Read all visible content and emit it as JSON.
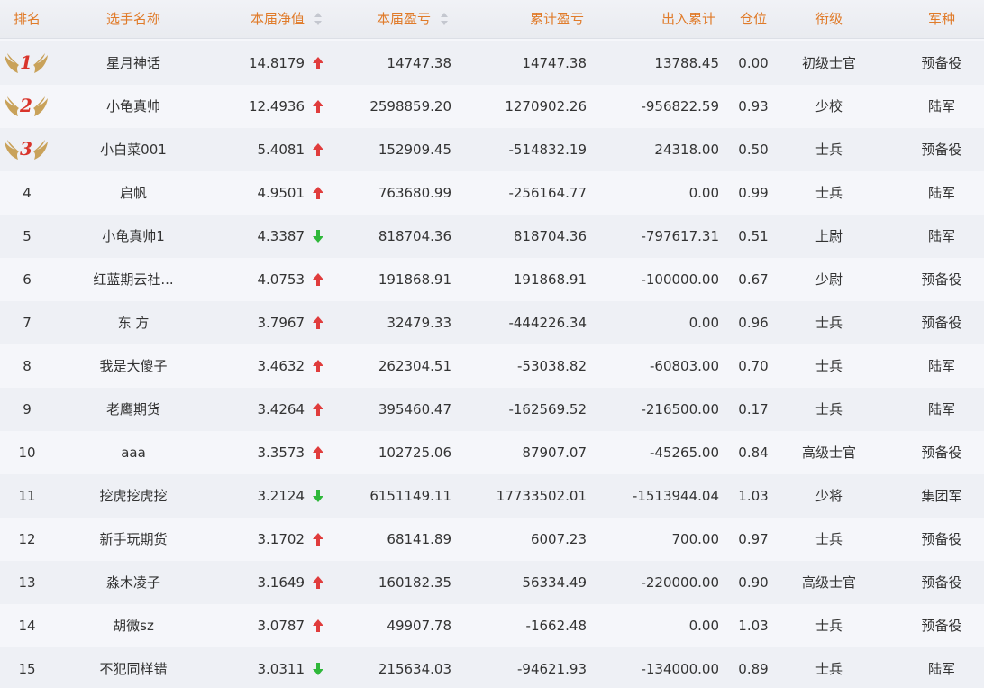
{
  "headers": {
    "rank": "排名",
    "name": "选手名称",
    "net_value": "本届净值",
    "profit": "本届盈亏",
    "cum_profit": "累计盈亏",
    "in_out": "出入累计",
    "position": "仓位",
    "grade": "衔级",
    "branch": "军种"
  },
  "colors": {
    "header_text": "#e07b2a",
    "up_arrow": "#e03c3c",
    "down_arrow": "#2fb83a",
    "medal_wing": "#c9a25a",
    "medal_number": "#d9342b"
  },
  "icons": {
    "sort": "sort-icon",
    "up": "arrow-up-icon",
    "down": "arrow-down-icon",
    "medal": "winged-medal-icon"
  },
  "rows": [
    {
      "rank": "1",
      "name": "星月神话",
      "net_value": "14.8179",
      "trend": "up",
      "profit": "14747.38",
      "cum_profit": "14747.38",
      "in_out": "13788.45",
      "position": "0.00",
      "grade": "初级士官",
      "branch": "预备役"
    },
    {
      "rank": "2",
      "name": "小龟真帅",
      "net_value": "12.4936",
      "trend": "up",
      "profit": "2598859.20",
      "cum_profit": "1270902.26",
      "in_out": "-956822.59",
      "position": "0.93",
      "grade": "少校",
      "branch": "陆军"
    },
    {
      "rank": "3",
      "name": "小白菜001",
      "net_value": "5.4081",
      "trend": "up",
      "profit": "152909.45",
      "cum_profit": "-514832.19",
      "in_out": "24318.00",
      "position": "0.50",
      "grade": "士兵",
      "branch": "预备役"
    },
    {
      "rank": "4",
      "name": "启帆",
      "net_value": "4.9501",
      "trend": "up",
      "profit": "763680.99",
      "cum_profit": "-256164.77",
      "in_out": "0.00",
      "position": "0.99",
      "grade": "士兵",
      "branch": "陆军"
    },
    {
      "rank": "5",
      "name": "小龟真帅1",
      "net_value": "4.3387",
      "trend": "down",
      "profit": "818704.36",
      "cum_profit": "818704.36",
      "in_out": "-797617.31",
      "position": "0.51",
      "grade": "上尉",
      "branch": "陆军"
    },
    {
      "rank": "6",
      "name": "红蓝期云社...",
      "net_value": "4.0753",
      "trend": "up",
      "profit": "191868.91",
      "cum_profit": "191868.91",
      "in_out": "-100000.00",
      "position": "0.67",
      "grade": "少尉",
      "branch": "预备役"
    },
    {
      "rank": "7",
      "name": "东 方",
      "net_value": "3.7967",
      "trend": "up",
      "profit": "32479.33",
      "cum_profit": "-444226.34",
      "in_out": "0.00",
      "position": "0.96",
      "grade": "士兵",
      "branch": "预备役"
    },
    {
      "rank": "8",
      "name": "我是大傻子",
      "net_value": "3.4632",
      "trend": "up",
      "profit": "262304.51",
      "cum_profit": "-53038.82",
      "in_out": "-60803.00",
      "position": "0.70",
      "grade": "士兵",
      "branch": "陆军"
    },
    {
      "rank": "9",
      "name": "老鹰期货",
      "net_value": "3.4264",
      "trend": "up",
      "profit": "395460.47",
      "cum_profit": "-162569.52",
      "in_out": "-216500.00",
      "position": "0.17",
      "grade": "士兵",
      "branch": "陆军"
    },
    {
      "rank": "10",
      "name": "aaa",
      "net_value": "3.3573",
      "trend": "up",
      "profit": "102725.06",
      "cum_profit": "87907.07",
      "in_out": "-45265.00",
      "position": "0.84",
      "grade": "高级士官",
      "branch": "预备役"
    },
    {
      "rank": "11",
      "name": "挖虎挖虎挖",
      "net_value": "3.2124",
      "trend": "down",
      "profit": "6151149.11",
      "cum_profit": "17733502.01",
      "in_out": "-1513944.04",
      "position": "1.03",
      "grade": "少将",
      "branch": "集团军"
    },
    {
      "rank": "12",
      "name": "新手玩期货",
      "net_value": "3.1702",
      "trend": "up",
      "profit": "68141.89",
      "cum_profit": "6007.23",
      "in_out": "700.00",
      "position": "0.97",
      "grade": "士兵",
      "branch": "预备役"
    },
    {
      "rank": "13",
      "name": "淼木凌子",
      "net_value": "3.1649",
      "trend": "up",
      "profit": "160182.35",
      "cum_profit": "56334.49",
      "in_out": "-220000.00",
      "position": "0.90",
      "grade": "高级士官",
      "branch": "预备役"
    },
    {
      "rank": "14",
      "name": "胡微sz",
      "net_value": "3.0787",
      "trend": "up",
      "profit": "49907.78",
      "cum_profit": "-1662.48",
      "in_out": "0.00",
      "position": "1.03",
      "grade": "士兵",
      "branch": "预备役"
    },
    {
      "rank": "15",
      "name": "不犯同样错",
      "net_value": "3.0311",
      "trend": "down",
      "profit": "215634.03",
      "cum_profit": "-94621.93",
      "in_out": "-134000.00",
      "position": "0.89",
      "grade": "士兵",
      "branch": "陆军"
    }
  ]
}
